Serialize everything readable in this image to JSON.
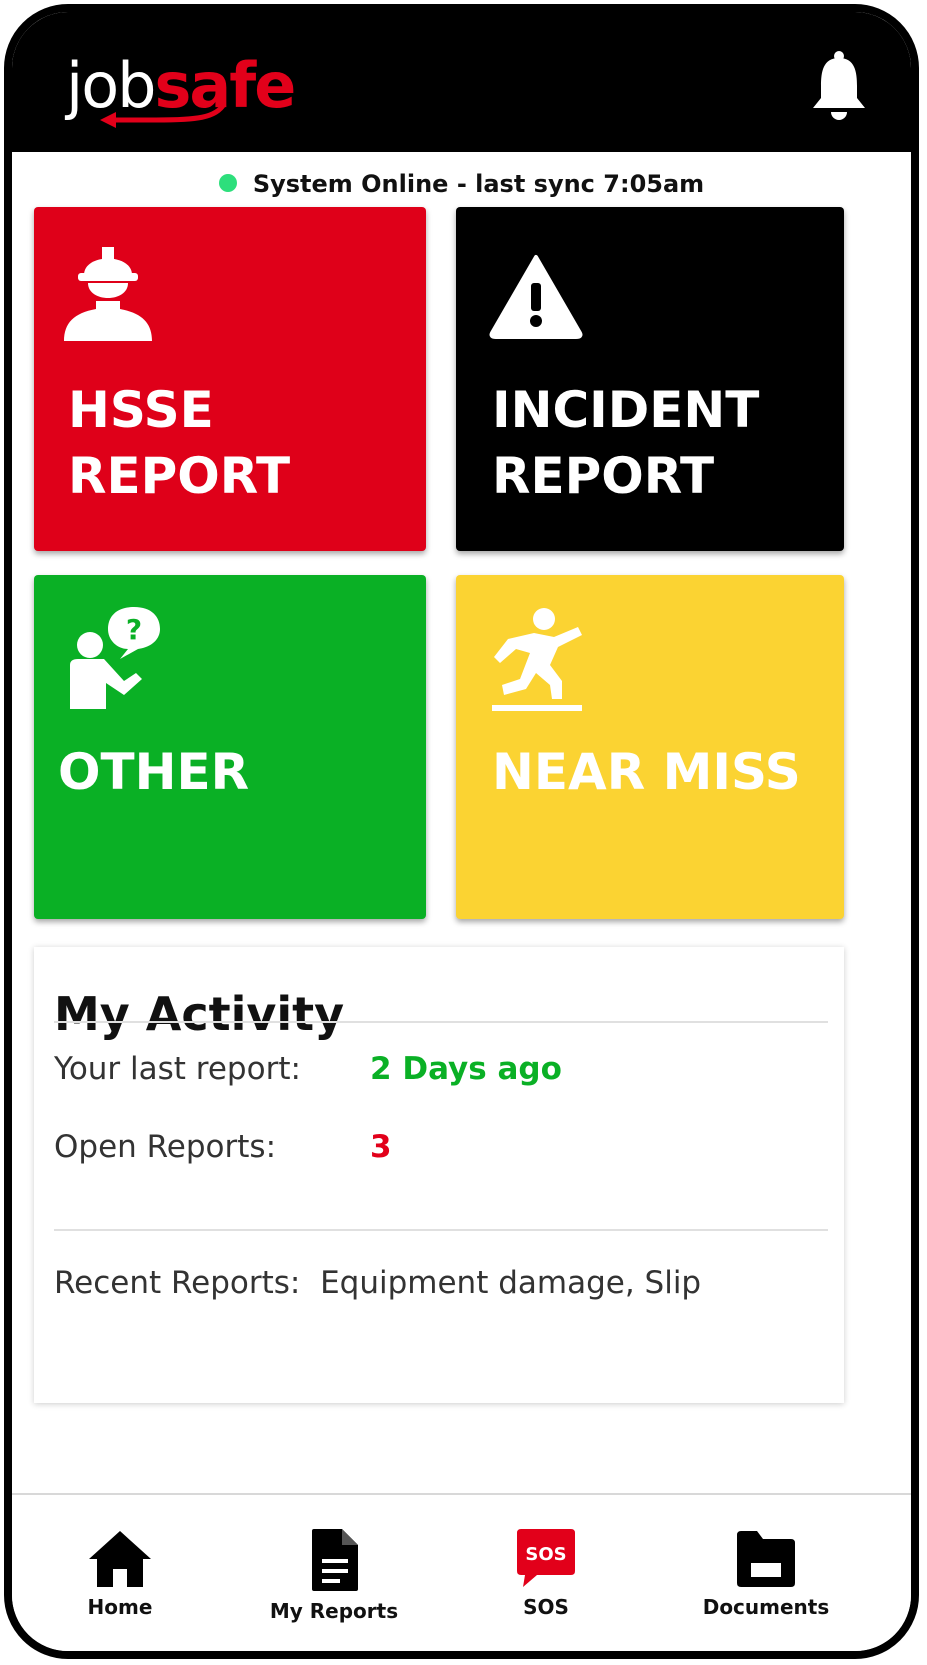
{
  "app": {
    "logo_part1": "job",
    "logo_part2": "safe",
    "brand_color": "#e2001a"
  },
  "header": {
    "notification_icon": "bell-icon"
  },
  "status": {
    "text": "System Online - last sync 7:05am",
    "indicator_color": "#2ddf7c"
  },
  "tiles": [
    {
      "label": "HSSE\nREPORT",
      "icon": "worker-hardhat-icon",
      "color": "#df0019"
    },
    {
      "label": "INCIDENT\nREPORT",
      "icon": "warning-triangle-icon",
      "color": "#000000"
    },
    {
      "label": "OTHER",
      "icon": "person-question-icon",
      "color": "#0ab025"
    },
    {
      "label": "NEAR MISS",
      "icon": "slip-fall-icon",
      "color": "#fbd332"
    }
  ],
  "activity": {
    "title": "My Activity",
    "last_report_label": "Your last report:",
    "last_report_value": "2 Days ago",
    "open_reports_label": "Open Reports:",
    "open_reports_value": "3",
    "recent_label": "Recent Reports:",
    "recent_value": "Equipment damage, Slip"
  },
  "nav": {
    "items": [
      {
        "label": "Home",
        "icon": "home-icon"
      },
      {
        "label": "My Reports",
        "icon": "document-icon"
      },
      {
        "label": "SOS",
        "icon": "sos-icon"
      },
      {
        "label": "Documents",
        "icon": "folder-icon"
      }
    ]
  }
}
